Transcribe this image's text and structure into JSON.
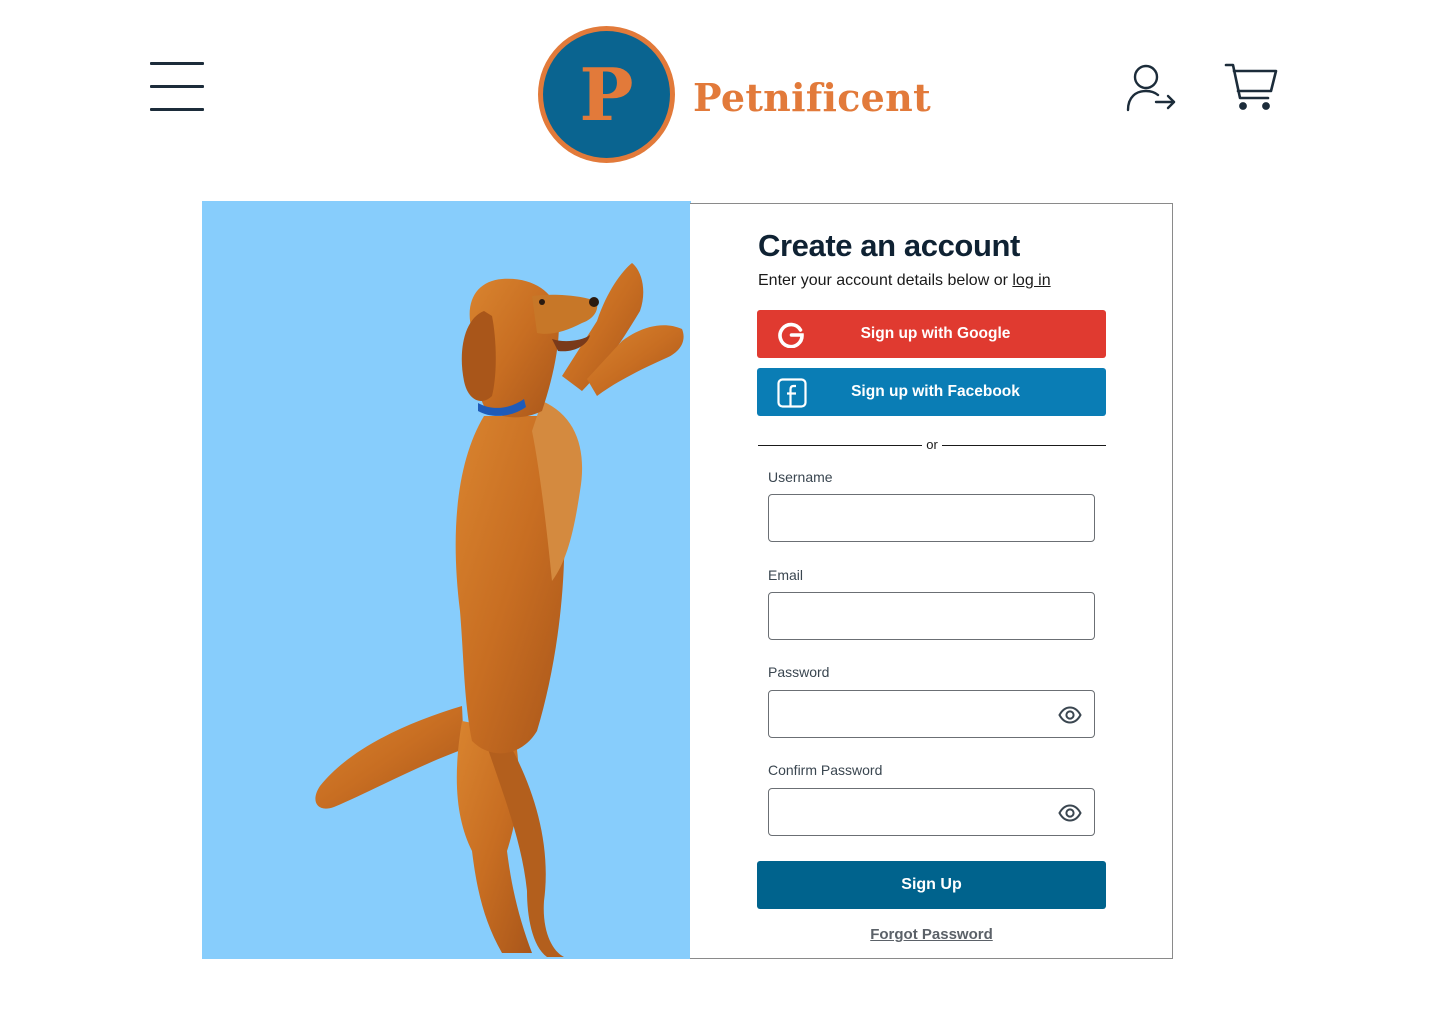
{
  "header": {
    "menu_icon": "hamburger-menu-icon",
    "logo_letter": "P",
    "brand_name": "Petnificent",
    "login_icon": "user-arrow-icon",
    "cart_icon": "shopping-cart-icon"
  },
  "hero": {
    "image": "golden retriever standing on hind legs",
    "background_color": "#87cdfc"
  },
  "form": {
    "title": "Create an account",
    "subtitle_prefix": "Enter your account details below or ",
    "login_link": "log in",
    "google_button": "Sign up with Google",
    "facebook_button": "Sign up with Facebook",
    "divider_text": "or",
    "fields": [
      {
        "label": "Username",
        "value": "",
        "type": "text"
      },
      {
        "label": "Email",
        "value": "",
        "type": "email"
      },
      {
        "label": "Password",
        "value": "",
        "type": "password",
        "toggle_icon": "eye-icon"
      },
      {
        "label": "Confirm Password",
        "value": "",
        "type": "password",
        "toggle_icon": "eye-icon"
      }
    ],
    "submit_button": "Sign Up",
    "forgot_link": "Forgot Password"
  },
  "colors": {
    "brand_orange": "#e27a3a",
    "brand_blue": "#0a6490",
    "google_red": "#e03a30",
    "facebook_blue": "#0a7db5",
    "primary_button": "#00638d"
  }
}
